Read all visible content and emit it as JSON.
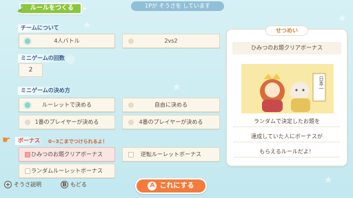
{
  "header": {
    "title": "ルールをつくる",
    "status": "1Pが そうさを しています"
  },
  "sections": {
    "team": {
      "label": "チームについて",
      "options": [
        "4人バトル",
        "2vs2"
      ]
    },
    "rounds": {
      "label": "ミニゲームの回数",
      "value": "2"
    },
    "method": {
      "label": "ミニゲームの決め方",
      "options": [
        "ルーレットで決める",
        "自由に決める",
        "1番のプレイヤーが決める",
        "4番のプレイヤーが決める"
      ]
    },
    "bonus": {
      "label": "ボーナス",
      "warning": "0~3こまでつけられるよ！",
      "options": [
        "ひみつのお題クリアボーナス",
        "逆転ルーレットボーナス",
        "ランダムルーレットボーナス"
      ]
    }
  },
  "panel": {
    "heading": "せつめい",
    "title": "ひみつのお題クリアボーナス",
    "sign_text": "日本一",
    "lines": [
      "ランダムで決定したお題を",
      "達成していた人にボーナスが",
      "もらえるルールだよ！"
    ]
  },
  "footer": {
    "help": "そうさ説明",
    "back": "もどる",
    "confirm": "これにする"
  },
  "icons": {
    "plus": "+",
    "b_button": "B",
    "a_button": "A",
    "finger": "pointing-hand-icon"
  },
  "colors": {
    "accent": "#f47b3c",
    "title_tab": "#8cc63f",
    "selected": "#8dd3c7"
  }
}
